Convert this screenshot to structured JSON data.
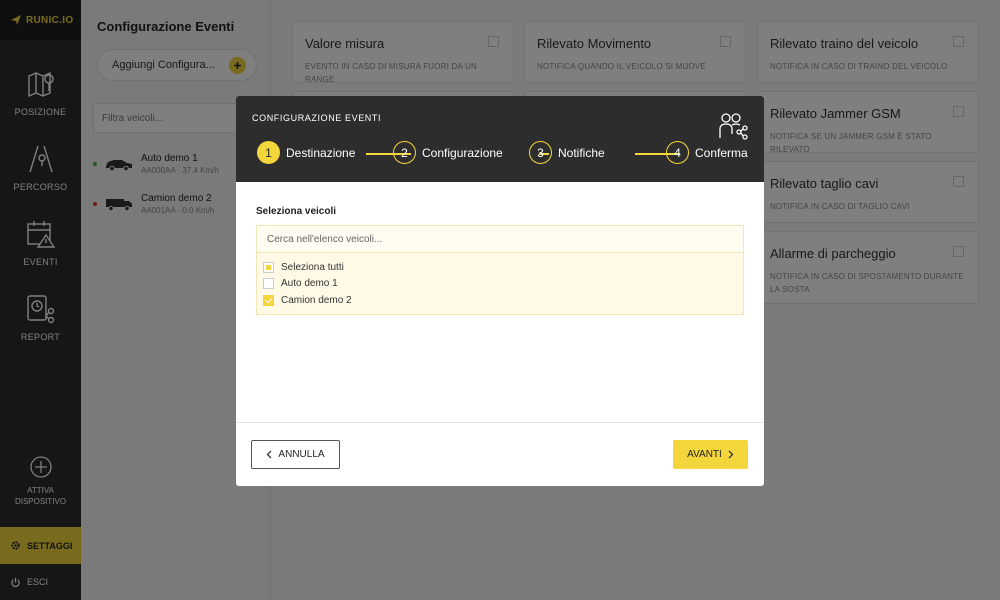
{
  "brand": {
    "name": "RUNIC.IO",
    "accent": "#f2d63c"
  },
  "nav": {
    "items": [
      {
        "label": "POSIZIONE",
        "icon": "map-pin-icon"
      },
      {
        "label": "PERCORSO",
        "icon": "route-icon"
      },
      {
        "label": "EVENTI",
        "icon": "calendar-alert-icon"
      },
      {
        "label": "REPORT",
        "icon": "report-icon"
      }
    ],
    "attiva_line1": "ATTIVA",
    "attiva_line2": "DISPOSITIVO",
    "settaggi": "SETTAGGI",
    "esci": "ESCI"
  },
  "panel": {
    "title": "Configurazione Eventi",
    "add_label": "Aggiungi Configura...",
    "filter_placeholder": "Filtra veicoli...",
    "vehicles": [
      {
        "name": "Auto demo 1",
        "sub": "AA000AA · 37.4 Km/h",
        "status_color": "#4caf50",
        "icon": "car-icon"
      },
      {
        "name": "Camion demo 2",
        "sub": "AA001AA · 0.0 Km/h",
        "status_color": "#e53935",
        "icon": "truck-icon"
      }
    ]
  },
  "cards": [
    {
      "title": "Valore misura",
      "desc": "EVENTO IN CASO DI MISURA FUORI DA UN RANGE"
    },
    {
      "title": "Rilevato Movimento",
      "desc": "NOTIFICA QUANDO IL VEICOLO SI MUOVE"
    },
    {
      "title": "Rilevato traino del veicolo",
      "desc": "NOTIFICA IN CASO DI TRAINO DEL VEICOLO"
    },
    {
      "title": "Rilevato Jammer GSM",
      "desc": "NOTIFICA SE UN JAMMER GSM È STATO RILEVATO"
    },
    {
      "title": "Rilevato taglio cavi",
      "desc": "NOTIFICA IN CASO DI TAGLIO CAVI"
    },
    {
      "title": "Allarme di parcheggio",
      "desc": "NOTIFICA IN CASO DI SPOSTAMENTO DURANTE LA SOSTA"
    }
  ],
  "modal": {
    "title": "CONFIGURAZIONE EVENTI",
    "steps": [
      {
        "num": "1",
        "label": "Destinazione",
        "active": true
      },
      {
        "num": "2",
        "label": "Configurazione",
        "active": false
      },
      {
        "num": "3",
        "label": "Notifiche",
        "active": false
      },
      {
        "num": "4",
        "label": "Conferma",
        "active": false
      }
    ],
    "section_label": "Seleziona veicoli",
    "search_placeholder": "Cerca nell'elenco veicoli...",
    "options": [
      {
        "label": "Seleziona tutti",
        "state": "partial"
      },
      {
        "label": "Auto demo 1",
        "state": "unchecked"
      },
      {
        "label": "Camion demo 2",
        "state": "checked"
      }
    ],
    "cancel_label": "ANNULLA",
    "next_label": "AVANTI"
  }
}
